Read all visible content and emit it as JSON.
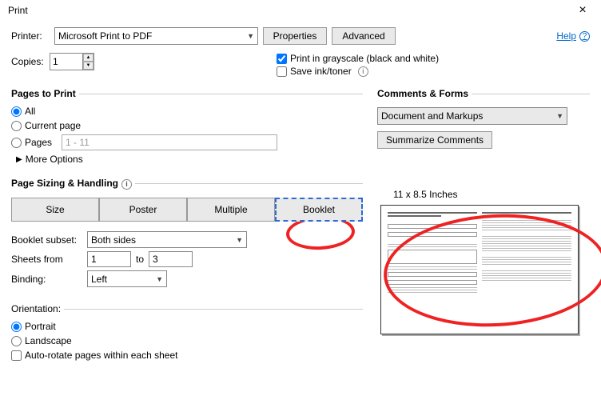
{
  "title": "Print",
  "printer": {
    "label": "Printer:",
    "value": "Microsoft Print to PDF",
    "properties": "Properties",
    "advanced": "Advanced"
  },
  "help": "Help",
  "copies": {
    "label": "Copies:",
    "value": "1"
  },
  "check": {
    "grayscale": "Print in grayscale (black and white)",
    "saveink": "Save ink/toner"
  },
  "pages": {
    "legend": "Pages to Print",
    "all": "All",
    "current": "Current page",
    "pages": "Pages",
    "placeholder": "1 - 11",
    "more": "More Options"
  },
  "sizing": {
    "legend": "Page Sizing & Handling",
    "size": "Size",
    "poster": "Poster",
    "multiple": "Multiple",
    "booklet": "Booklet"
  },
  "booklet": {
    "subset_label": "Booklet subset:",
    "subset_value": "Both sides",
    "sheets_label": "Sheets from",
    "from": "1",
    "to_label": "to",
    "to": "3",
    "binding_label": "Binding:",
    "binding_value": "Left"
  },
  "orientation": {
    "legend": "Orientation:",
    "portrait": "Portrait",
    "landscape": "Landscape",
    "autorotate": "Auto-rotate pages within each sheet"
  },
  "comments": {
    "legend": "Comments & Forms",
    "value": "Document and Markups",
    "summarize": "Summarize Comments"
  },
  "preview": {
    "caption": "11 x 8.5 Inches"
  }
}
